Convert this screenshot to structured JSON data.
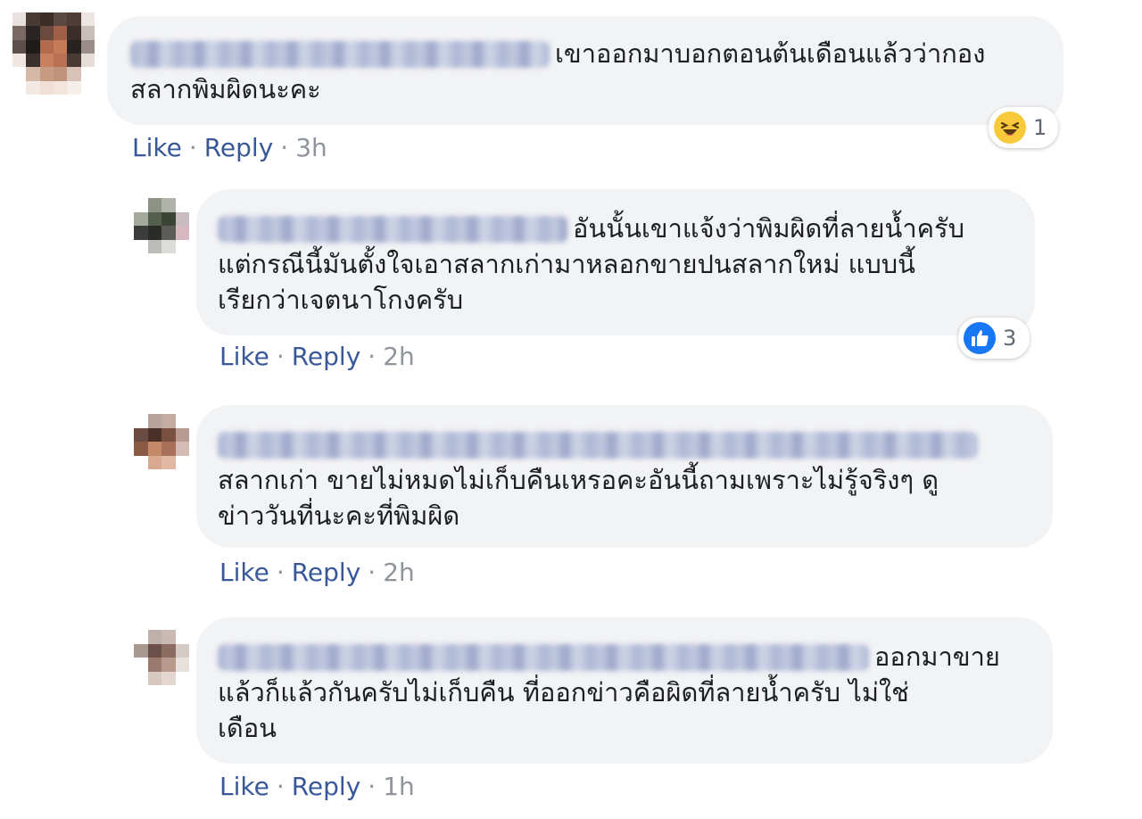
{
  "comments": [
    {
      "text_line1": "เขาออกมาบอกตอนต้นเดือนแล้วว่ากอง",
      "text_line2": "สลากพิมผิดนะคะ",
      "text_line3": "",
      "actions": {
        "like": "Like",
        "reply": "Reply",
        "time": "3h",
        "sep": "·"
      },
      "reaction": {
        "icon": "haha-icon",
        "count": "1"
      }
    },
    {
      "text_line1": "อันนั้นเขาแจ้งว่าพิมผิดที่ลายน้ำครับ",
      "text_line2": "แต่กรณีนี้มันตั้งใจเอาสลากเก่ามาหลอกขายปนสลากใหม่ แบบนี้",
      "text_line3": "เรียกว่าเจตนาโกงครับ",
      "actions": {
        "like": "Like",
        "reply": "Reply",
        "time": "2h",
        "sep": "·"
      },
      "reaction": {
        "icon": "like-thumb-icon",
        "count": "3"
      }
    },
    {
      "text_line1": "",
      "text_line2": "สลากเก่า ขายไม่หมดไม่เก็บคืนเหรอคะอันนี้ถามเพราะไม่รู้จริงๆ ดู",
      "text_line3": "ข่าววันที่นะคะที่พิมผิด",
      "actions": {
        "like": "Like",
        "reply": "Reply",
        "time": "2h",
        "sep": "·"
      }
    },
    {
      "text_line1": "ออกมาขาย",
      "text_line2": "แล้วก็แล้วกันครับไม่เก็บคืน ที่ออกข่าวคือผิดที่ลายน้ำครับ ไม่ใช่",
      "text_line3": "เดือน",
      "actions": {
        "like": "Like",
        "reply": "Reply",
        "time": "1h",
        "sep": "·"
      }
    }
  ],
  "colors": {
    "bubble": "#f2f3f5",
    "link": "#385898",
    "meta": "#90949c",
    "haha": "#f7c93b",
    "like": "#1877f2"
  }
}
